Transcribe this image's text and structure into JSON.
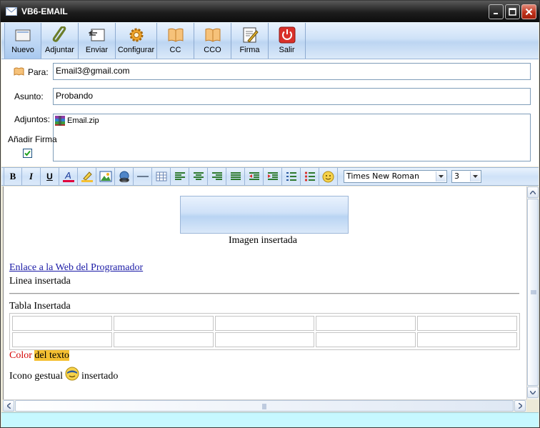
{
  "window": {
    "title": "VB6-EMAIL"
  },
  "toolbar": {
    "buttons": [
      {
        "label": "Nuevo",
        "icon": "new-icon"
      },
      {
        "label": "Adjuntar",
        "icon": "paperclip-icon"
      },
      {
        "label": "Enviar",
        "icon": "send-icon"
      },
      {
        "label": "Configurar",
        "icon": "gear-icon"
      },
      {
        "label": "CC",
        "icon": "address-book-icon"
      },
      {
        "label": "CCO",
        "icon": "address-book-icon"
      },
      {
        "label": "Firma",
        "icon": "signature-icon"
      },
      {
        "label": "Salir",
        "icon": "power-icon"
      }
    ]
  },
  "form": {
    "to_label": "Para:",
    "to_value": "Email3@gmail.com",
    "subject_label": "Asunto:",
    "subject_value": "Probando",
    "attachments_label": "Adjuntos:",
    "attachment_file": "Email.zip",
    "signature_label": "Añadir Firma",
    "signature_checked": true
  },
  "format_toolbar": {
    "font": "Times New Roman",
    "size": "3",
    "bold_label": "B",
    "italic_label": "I",
    "underline_label": "U",
    "color_label": "A"
  },
  "editor": {
    "image_caption": "Imagen insertada",
    "link_text": "Enlace a la Web del Programador",
    "line_text": "Linea insertada",
    "table_title": "Tabla Insertada",
    "table_rows": 2,
    "table_cols": 5,
    "color_word": "Color",
    "highlight_text": "del texto",
    "emoticon_before": "Icono gestual",
    "emoticon_after": "insertado",
    "colors": {
      "red": "#d40000",
      "highlight": "#f5c032",
      "link": "#1a1aa6"
    }
  }
}
